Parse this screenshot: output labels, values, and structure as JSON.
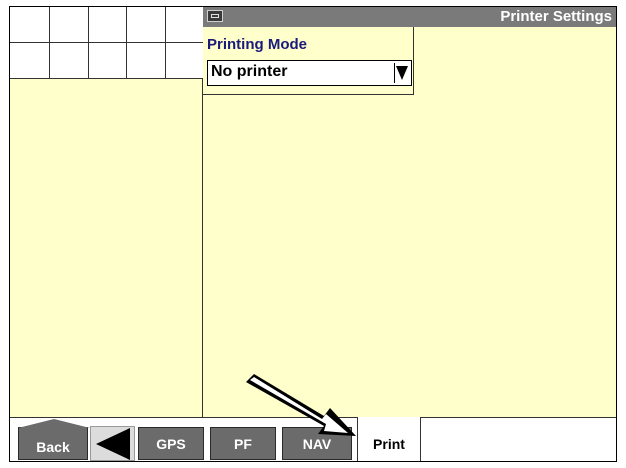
{
  "window": {
    "title": "Printer Settings",
    "title_icon": "printer-icon"
  },
  "printing_mode": {
    "label": "Printing Mode",
    "value": "No printer",
    "dropdown_icon": "dropdown-arrow-icon"
  },
  "tab_bar": {
    "back_label": "Back",
    "left_arrow_icon": "left-arrow-icon",
    "tabs": [
      {
        "label": "GPS",
        "active": false
      },
      {
        "label": "PF",
        "active": false
      },
      {
        "label": "NAV",
        "active": false
      },
      {
        "label": "Print",
        "active": true
      }
    ]
  },
  "annotation": {
    "pointer_icon": "callout-arrow-icon"
  },
  "colors": {
    "background": "#ffffcc",
    "title_bar": "#7a7a7a",
    "label_text": "#1a1a7a",
    "button": "#6b6b6b"
  }
}
